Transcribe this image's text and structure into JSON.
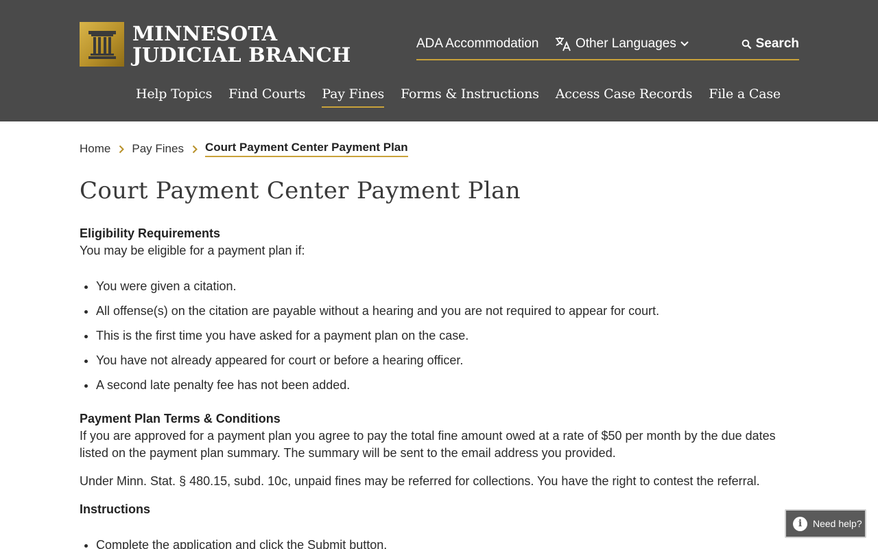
{
  "header": {
    "logo_line1": "MINNESOTA",
    "logo_line2": "JUDICIAL BRANCH",
    "utility": {
      "ada": "ADA Accommodation",
      "languages": "Other Languages",
      "search": "Search"
    },
    "nav": [
      {
        "label": "Help Topics"
      },
      {
        "label": "Find Courts"
      },
      {
        "label": "Pay Fines",
        "active": true
      },
      {
        "label": "Forms & Instructions"
      },
      {
        "label": "Access Case Records"
      },
      {
        "label": "File a Case"
      }
    ]
  },
  "breadcrumb": {
    "home": "Home",
    "parent": "Pay Fines",
    "current": "Court Payment Center Payment Plan"
  },
  "page_title": "Court Payment Center Payment Plan",
  "eligibility": {
    "heading": "Eligibility Requirements",
    "intro": "You may be eligible for a payment plan if:",
    "items": [
      "You were given a citation.",
      "All offense(s) on the citation are payable without a hearing and you are not required to appear for court.",
      "This is the first time you have asked for a payment plan on the case.",
      "You have not already appeared for court or before a hearing officer.",
      "A second late penalty fee has not been added."
    ]
  },
  "terms": {
    "heading": "Payment Plan Terms & Conditions",
    "body": "If you are approved for a payment plan you agree to pay the total fine amount owed at a rate of $50 per month by the due dates listed on the payment plan summary.  The summary will be sent to the email address you provided.",
    "statute_link": "Under Minn. Stat. § 480.15, subd. 10c",
    "statute_rest": ", unpaid fines may be referred for collections.  You have the right to contest the referral."
  },
  "instructions": {
    "heading": "Instructions",
    "items": [
      "Complete the application and click the Submit button."
    ]
  },
  "help_button": "Need help?",
  "colors": {
    "header_bg": "#4a4a4a",
    "accent_gold": "#c9a23a"
  }
}
